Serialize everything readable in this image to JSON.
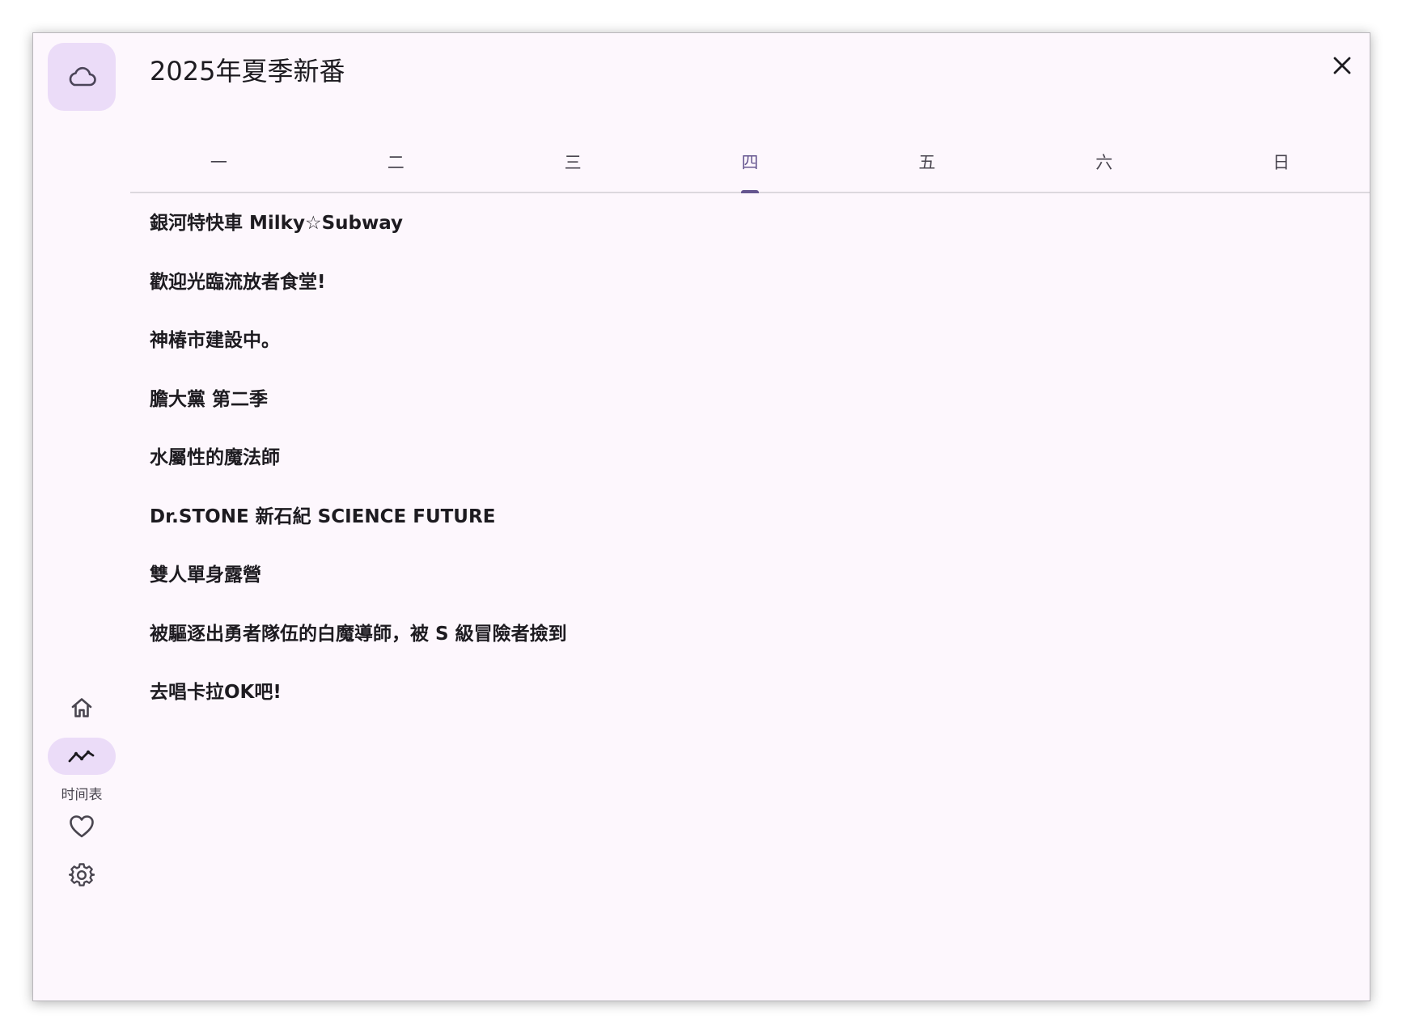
{
  "header": {
    "title": "2025年夏季新番"
  },
  "tabs": [
    {
      "label": "一",
      "active": false
    },
    {
      "label": "二",
      "active": false
    },
    {
      "label": "三",
      "active": false
    },
    {
      "label": "四",
      "active": true
    },
    {
      "label": "五",
      "active": false
    },
    {
      "label": "六",
      "active": false
    },
    {
      "label": "日",
      "active": false
    }
  ],
  "anime_list": [
    "銀河特快車 Milky☆Subway",
    "歡迎光臨流放者食堂!",
    "神椿市建設中。",
    "膽大黨 第二季",
    "水屬性的魔法師",
    "Dr.STONE 新石紀 SCIENCE FUTURE",
    "雙人單身露營",
    "被驅逐出勇者隊伍的白魔導師，被 S 級冒險者撿到",
    "去唱卡拉OK吧!"
  ],
  "nav": {
    "fab_icon": "cloud-icon",
    "items": [
      {
        "icon": "home-icon",
        "label": "",
        "active": false
      },
      {
        "icon": "timeline-icon",
        "label": "时间表",
        "active": true
      },
      {
        "icon": "heart-icon",
        "label": "",
        "active": false
      },
      {
        "icon": "gear-icon",
        "label": "",
        "active": false
      }
    ]
  },
  "colors": {
    "background": "#fdf7fd",
    "accent": "#65558f",
    "indicator": "#ebdcf8",
    "text": "#1d1b20"
  }
}
